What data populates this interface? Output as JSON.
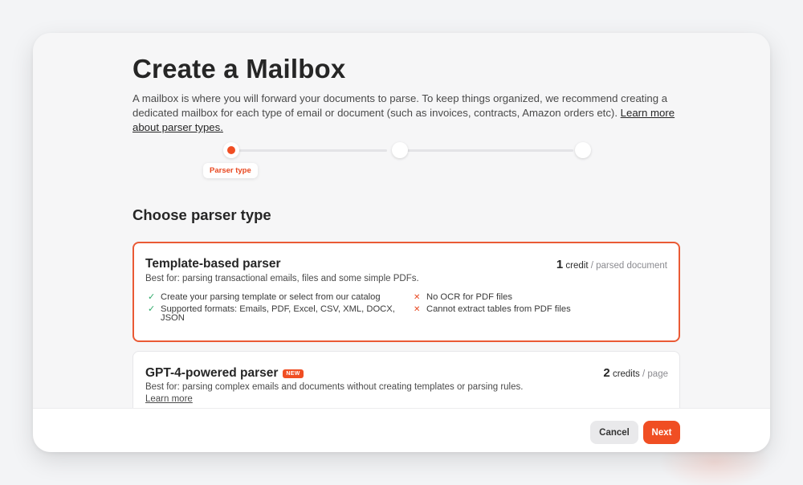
{
  "page": {
    "title": "Create a Mailbox",
    "description": "A mailbox is where you will forward your documents to parse. To keep things organized, we recommend creating a dedicated mailbox for each type of email or document (such as invoices, contracts, Amazon orders etc).",
    "description_link": "Learn more about parser types."
  },
  "stepper": {
    "steps": [
      {
        "label": "Parser type",
        "active": true
      },
      {
        "label": "",
        "active": false
      },
      {
        "label": "",
        "active": false
      }
    ]
  },
  "section": {
    "title": "Choose parser type"
  },
  "parsers": [
    {
      "name": "Template-based parser",
      "badge": "",
      "price_number": "1",
      "price_unit": "credit",
      "price_suffix": "/ parsed document",
      "best_for": "Best for: parsing transactional emails, files and some simple PDFs.",
      "pros": [
        "Create your parsing template or select from our catalog",
        "Supported formats: Emails, PDF, Excel, CSV, XML, DOCX, JSON"
      ],
      "cons": [
        "No OCR for PDF files",
        "Cannot extract tables from PDF files"
      ],
      "selected": true
    },
    {
      "name": "GPT-4-powered parser",
      "badge": "NEW",
      "price_number": "2",
      "price_unit": "credits",
      "price_suffix": "/ page",
      "best_for": "Best for: parsing complex emails and documents without creating templates or parsing rules.",
      "link": "Learn more",
      "selected": false
    }
  ],
  "footer": {
    "cancel_label": "Cancel",
    "next_label": "Next"
  },
  "icons": {
    "pro": "check-icon",
    "con": "cross-icon"
  },
  "colors": {
    "accent": "#f04e23",
    "success": "#2eaa6a",
    "text": "#262626"
  }
}
